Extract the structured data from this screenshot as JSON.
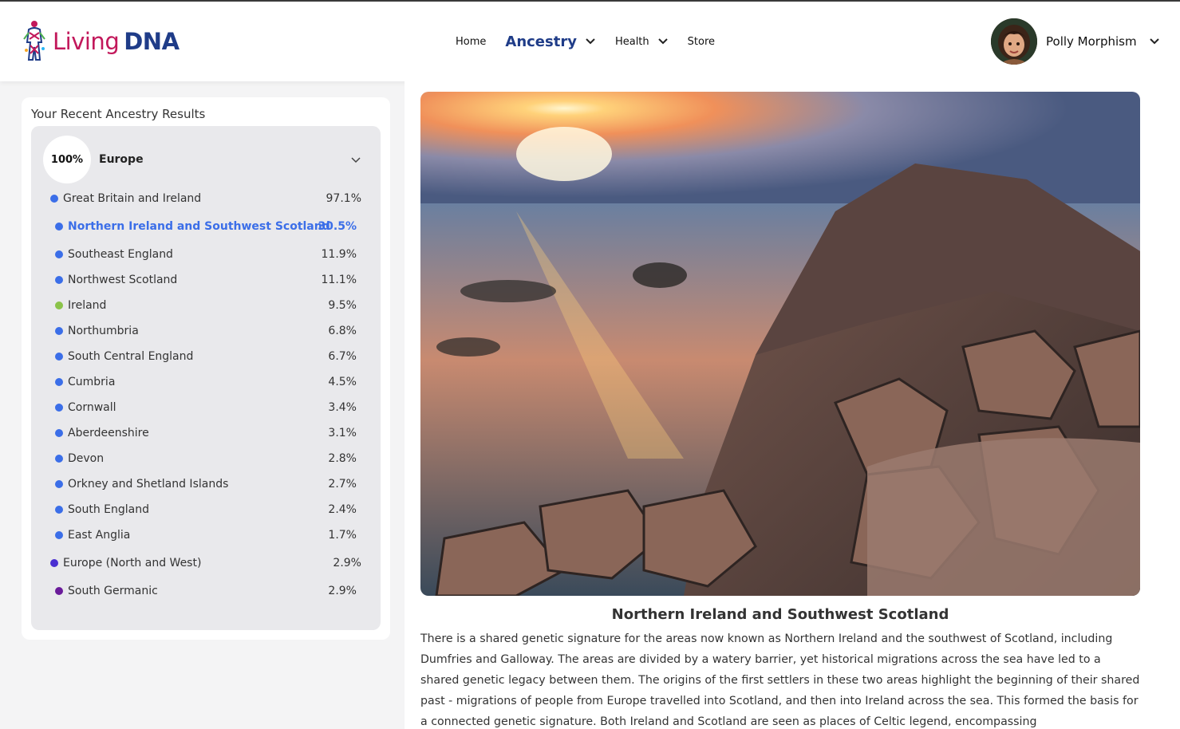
{
  "brand": {
    "living": "Living",
    "dna": "DNA"
  },
  "nav": {
    "home": "Home",
    "ancestry": "Ancestry",
    "health": "Health",
    "store": "Store"
  },
  "user": {
    "name": "Polly Morphism"
  },
  "sidebar": {
    "title": "Your Recent Ancestry Results",
    "region": {
      "percent": "100%",
      "name": "Europe"
    },
    "rows": [
      {
        "label": "Great Britain and Ireland",
        "value": "97.1%",
        "color": "#3b6ee8",
        "level": "top"
      },
      {
        "label": "Northern Ireland and Southwest Scotland",
        "value": "30.5%",
        "color": "#3b6ee8",
        "level": "sub",
        "selected": true
      },
      {
        "label": "Southeast England",
        "value": "11.9%",
        "color": "#3b6ee8",
        "level": "sub"
      },
      {
        "label": "Northwest Scotland",
        "value": "11.1%",
        "color": "#3b6ee8",
        "level": "sub"
      },
      {
        "label": "Ireland",
        "value": "9.5%",
        "color": "#8bc34a",
        "level": "sub"
      },
      {
        "label": "Northumbria",
        "value": "6.8%",
        "color": "#3b6ee8",
        "level": "sub"
      },
      {
        "label": "South Central England",
        "value": "6.7%",
        "color": "#3b6ee8",
        "level": "sub"
      },
      {
        "label": "Cumbria",
        "value": "4.5%",
        "color": "#3b6ee8",
        "level": "sub"
      },
      {
        "label": "Cornwall",
        "value": "3.4%",
        "color": "#3b6ee8",
        "level": "sub"
      },
      {
        "label": "Aberdeenshire",
        "value": "3.1%",
        "color": "#3b6ee8",
        "level": "sub"
      },
      {
        "label": "Devon",
        "value": "2.8%",
        "color": "#3b6ee8",
        "level": "sub"
      },
      {
        "label": "Orkney and Shetland Islands",
        "value": "2.7%",
        "color": "#3b6ee8",
        "level": "sub"
      },
      {
        "label": "South England",
        "value": "2.4%",
        "color": "#3b6ee8",
        "level": "sub"
      },
      {
        "label": "East Anglia",
        "value": "1.7%",
        "color": "#3b6ee8",
        "level": "sub"
      },
      {
        "label": "Europe (North and West)",
        "value": "2.9%",
        "color": "#4a2fd1",
        "level": "top"
      },
      {
        "label": "South Germanic",
        "value": "2.9%",
        "color": "#6a1b9a",
        "level": "sub"
      }
    ]
  },
  "detail": {
    "title": "Northern Ireland and Southwest Scotland",
    "description": "There is a shared genetic signature for the areas now known as Northern Ireland and the southwest of Scotland, including Dumfries and Galloway. The areas are divided by a watery barrier, yet historical migrations across the sea have led to a shared genetic legacy between them. The origins of the first settlers in these two areas highlight the beginning of their shared past - migrations of people from Europe travelled into Scotland, and then into Ireland across the sea. This formed the basis for a connected genetic signature. Both Ireland and Scotland are seen as places of Celtic legend, encompassing"
  },
  "colors": {
    "brand_pink": "#c2185b",
    "brand_navy": "#1f3c88",
    "selected_blue": "#3b6ee8"
  }
}
